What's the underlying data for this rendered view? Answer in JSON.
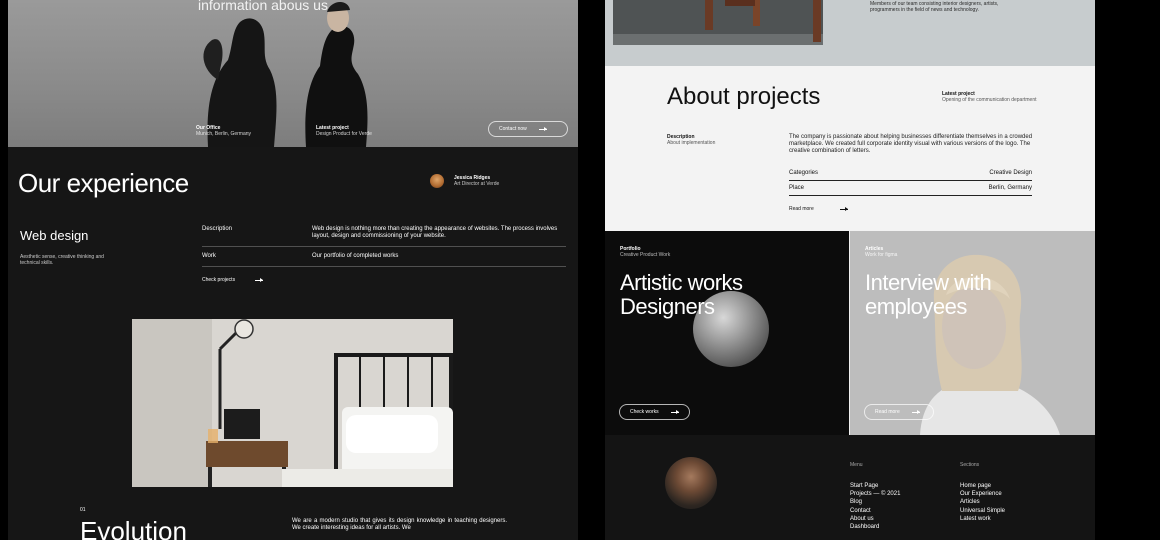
{
  "left": {
    "hero": {
      "heading": "information abous us.",
      "office_label": "Our Office",
      "office_value": "Munich, Berlin, Germany",
      "latest_label": "Latest project",
      "latest_value": "Design Product for Verde",
      "contact_button": "Contact now"
    },
    "experience": {
      "title": "Our experience",
      "person_name": "Jessica Ridges",
      "person_role": "Art Director at Verde",
      "service_title": "Web design",
      "service_note": "Aesthetic sense, creative thinking and technical skills.",
      "description_label": "Description",
      "description_text": "Web design is nothing more than creating the appearance of websites. The process involves layout, design and commissioning of your website.",
      "work_label": "Work",
      "work_text": "Our portfolio of completed works",
      "check_link": "Check projects"
    },
    "evolution": {
      "index": "01",
      "title": "Evolution",
      "text": "We are a modern studio that gives its design knowledge in teaching designers. We create interesting ideas for all artists. We"
    }
  },
  "right": {
    "top": {
      "team_text": "Members of our team consisting interior designers, artists, programmers in the field of news and technology."
    },
    "about": {
      "title": "About projects",
      "latest_label": "Latest project",
      "latest_value": "Opening of the communication department",
      "desc_label": "Description",
      "desc_value": "About implementation",
      "text": "The company is passionate about helping businesses differentiate themselves in a crowded marketplace. We created full corporate identity visual with various versions of the logo. The creative combination of letters.",
      "row1_label": "Categories",
      "row1_value": "Creative Design",
      "row2_label": "Place",
      "row2_value": "Berlin, Germany",
      "read_more": "Read more"
    },
    "artistic": {
      "label": "Portfolio",
      "sub": "Creative Product Work",
      "title_line1": "Artistic works",
      "title_line2": "Designers",
      "button": "Check works"
    },
    "interview": {
      "label": "Articles",
      "sub": "Work for figma",
      "title_line1": "Interview with",
      "title_line2": "employees",
      "button": "Read more"
    },
    "footer": {
      "menu_title": "Menu",
      "menu_items": [
        "Start Page",
        "Projects — © 2021",
        "Blog",
        "Contact",
        "About us",
        "Dashboard"
      ],
      "sections_title": "Sections",
      "section_items": [
        "Home page",
        "Our Experience",
        "Articles",
        "Universal Simple",
        "Latest work"
      ]
    }
  }
}
